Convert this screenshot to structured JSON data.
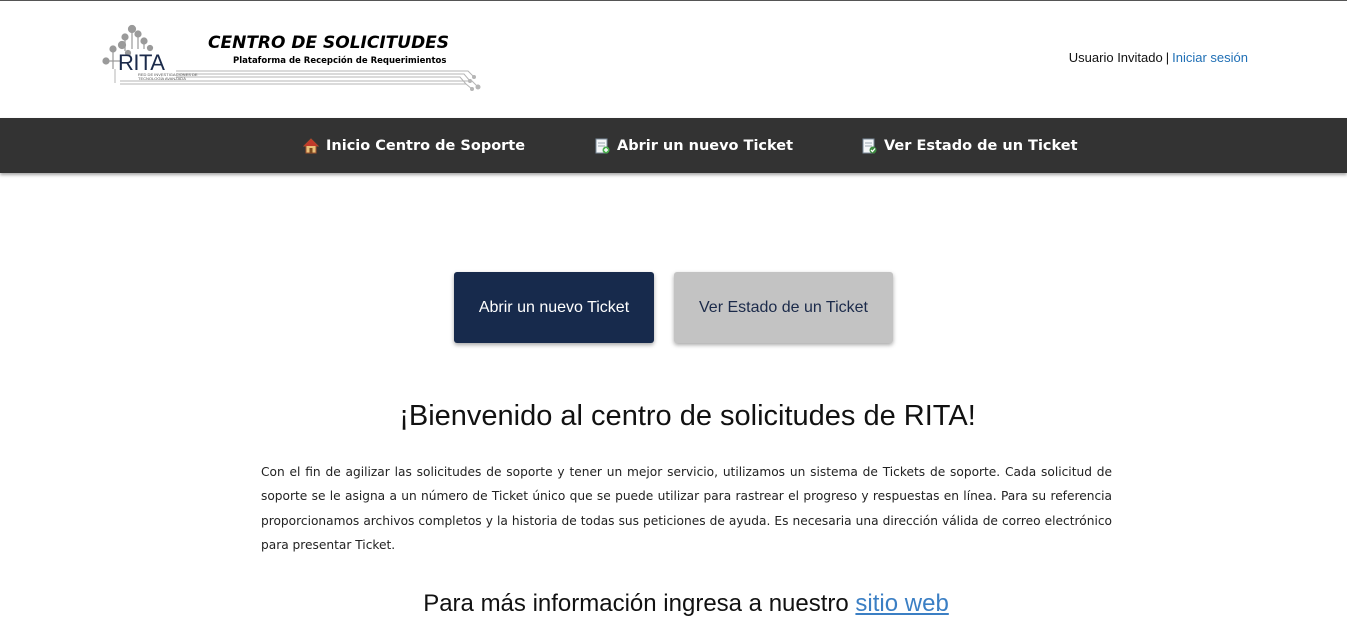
{
  "header": {
    "logo_text": "RITA",
    "logo_tagline": "RED DE INVESTIGACIONES DE TECNOLOGÍA AVANZADA",
    "site_title": "CENTRO DE SOLICITUDES",
    "site_subtitle": "Plataforma de Recepción de Requerimientos",
    "user_label": "Usuario Invitado",
    "separator": "|",
    "login_link": "Iniciar sesión"
  },
  "nav": {
    "items": [
      {
        "label": "Inicio Centro de Soporte",
        "icon": "home-icon"
      },
      {
        "label": "Abrir un nuevo Ticket",
        "icon": "new-ticket-icon"
      },
      {
        "label": "Ver Estado de un Ticket",
        "icon": "ticket-status-icon"
      }
    ]
  },
  "actions": {
    "new_ticket": "Abrir un nuevo Ticket",
    "check_status": "Ver Estado de un Ticket"
  },
  "main": {
    "welcome_title": "¡Bienvenido al centro de solicitudes de RITA!",
    "intro_text": "Con el fin de agilizar las solicitudes de soporte y tener un mejor servicio, utilizamos un sistema de Tickets de soporte. Cada solicitud de soporte se le asigna a un número de Ticket único que se puede utilizar para rastrear el progreso y respuestas en línea. Para su referencia proporcionamos archivos completos y la historia de todas sus peticiones de ayuda. Es necesaria una dirección válida de correo electrónico para presentar Ticket.",
    "more_info_text": "Para más información ingresa a nuestro",
    "more_info_link": "sitio web"
  },
  "colors": {
    "navbar_bg": "#333333",
    "primary_button": "#172a4c",
    "secondary_button": "#c3c3c3",
    "link": "#1f6fb5"
  }
}
